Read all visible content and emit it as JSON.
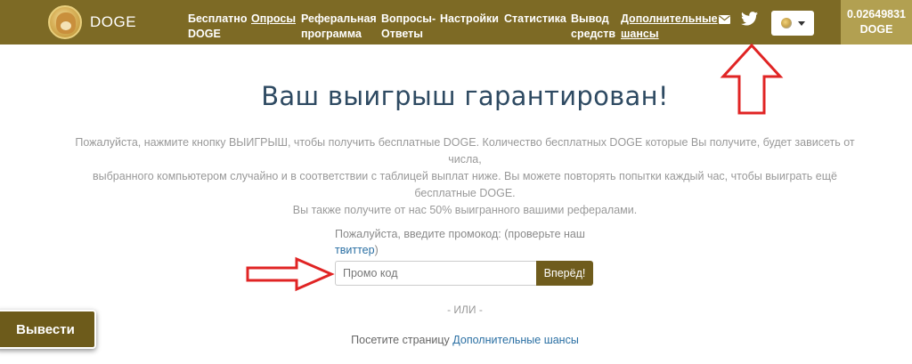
{
  "brand": {
    "name": "DOGE"
  },
  "nav": {
    "items": [
      {
        "line1": "Бесплатно",
        "line2": "DOGE"
      },
      {
        "line1": "Опросы",
        "line2": ""
      },
      {
        "line1": "Реферальная",
        "line2": "программа"
      },
      {
        "line1": "Вопросы-",
        "line2": "Ответы"
      },
      {
        "line1": "Настройки",
        "line2": ""
      },
      {
        "line1": "Статистика",
        "line2": ""
      },
      {
        "line1": "Вывод",
        "line2": "средств"
      },
      {
        "line1": "Дополнительные",
        "line2": "шансы"
      }
    ],
    "icons": [
      "envelope-icon",
      "twitter-icon"
    ],
    "language_icon": "globe-icon",
    "balance": {
      "amount": "0.02649831",
      "currency": "DOGE"
    }
  },
  "main": {
    "headline": "Ваш выигрыш гарантирован!",
    "description_lines": [
      "Пожалуйста, нажмите кнопку ВЫИГРЫШ, чтобы получить бесплатные DOGE. Количество бесплатных DOGE которые Вы получите, будет зависеть от числа,",
      "выбранного компьютером случайно и в соответствии с таблицей выплат ниже. Вы можете повторять попытки каждый час, чтобы выиграть ещё бесплатные DOGE.",
      "Вы также получите от нас 50% выигранного вашими рефералами."
    ],
    "promo": {
      "label_prefix": "Пожалуйста, введите промокод: (проверьте наш",
      "twitter_link": "твиттер",
      "label_suffix": ")",
      "placeholder": "Промо код",
      "value": "",
      "submit_label": "Вперёд!"
    },
    "or_text": "- ИЛИ -",
    "visit": {
      "prefix": "Посетите страницу ",
      "link": "Дополнительные шансы"
    }
  },
  "floating": {
    "withdraw_label": "Вывести"
  },
  "colors": {
    "navbar": "#7d6a25",
    "balance_bg": "#b2a051",
    "button": "#6f5c1d",
    "headline": "#2e4a62",
    "link": "#2a6fa3",
    "annotation_arrow": "#e02424"
  }
}
